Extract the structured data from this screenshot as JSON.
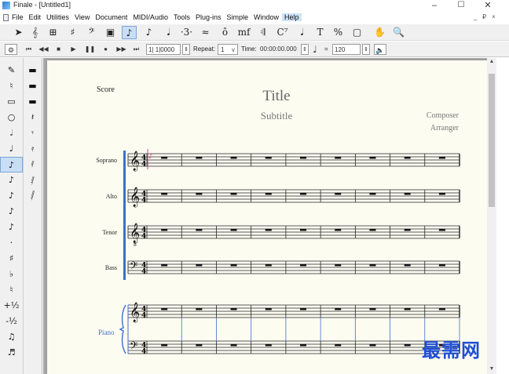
{
  "window": {
    "title": "Finale - [Untitled1]",
    "controls": {
      "minimize": "–",
      "maximize": "☐",
      "close": "✕"
    }
  },
  "menubar": {
    "items": [
      "File",
      "Edit",
      "Utilities",
      "View",
      "Document",
      "MIDI/Audio",
      "Tools",
      "Plug-ins",
      "Simple",
      "Window",
      "Help"
    ],
    "highlighted": "Help",
    "mdi_controls": {
      "minimize": "_",
      "restore": "₽",
      "close": "×"
    }
  },
  "main_tools": [
    {
      "name": "selection-tool",
      "glyph": "➤"
    },
    {
      "name": "staff-tool",
      "glyph": "𝄞"
    },
    {
      "name": "measure-tool",
      "glyph": "⊞"
    },
    {
      "name": "key-signature-tool",
      "glyph": "♯"
    },
    {
      "name": "time-signature-tool",
      "glyph": "𝄢"
    },
    {
      "name": "clef-tool",
      "glyph": "▣"
    },
    {
      "name": "simple-entry-tool",
      "glyph": "♪"
    },
    {
      "name": "speedy-entry-tool",
      "glyph": "♪"
    },
    {
      "name": "hyperscribe-tool",
      "glyph": "𝅘𝅥"
    },
    {
      "name": "tuplet-tool",
      "glyph": "·3·"
    },
    {
      "name": "smart-shape-tool",
      "glyph": "≈"
    },
    {
      "name": "articulation-tool",
      "glyph": "ô"
    },
    {
      "name": "expression-tool",
      "glyph": "mf"
    },
    {
      "name": "repeat-tool",
      "glyph": "𝄇"
    },
    {
      "name": "chord-tool",
      "glyph": "C⁷"
    },
    {
      "name": "lyrics-tool",
      "glyph": "𝅘𝅥"
    },
    {
      "name": "text-tool",
      "glyph": "T"
    },
    {
      "name": "resize-tool",
      "glyph": "%"
    },
    {
      "name": "page-layout-tool",
      "glyph": "▢"
    },
    {
      "name": "hand-grabber-tool",
      "glyph": "✋"
    },
    {
      "name": "zoom-tool",
      "glyph": "🔍"
    }
  ],
  "playback": {
    "buttons": [
      {
        "name": "rewind-to-start",
        "glyph": "⏮"
      },
      {
        "name": "rewind",
        "glyph": "◀◀"
      },
      {
        "name": "stop",
        "glyph": "■"
      },
      {
        "name": "play",
        "glyph": "▶"
      },
      {
        "name": "pause",
        "glyph": "❚❚"
      },
      {
        "name": "record",
        "glyph": "●"
      },
      {
        "name": "fast-forward",
        "glyph": "▶▶"
      },
      {
        "name": "forward-to-end",
        "glyph": "⏭"
      }
    ],
    "counter": "1| 1|0000",
    "repeat_label": "Repeat:",
    "repeat_value": "1",
    "time_label": "Time:",
    "time_value": "00:00:00.000",
    "equals": "=",
    "tempo": "120"
  },
  "simple_entry_palette": [
    {
      "name": "eraser-icon",
      "glyph": "✎"
    },
    {
      "name": "voice-icon",
      "glyph": "♮"
    },
    {
      "name": "tablature-icon",
      "glyph": "▭"
    },
    {
      "name": "whole-note-icon",
      "glyph": "○"
    },
    {
      "name": "half-note-icon",
      "glyph": "𝅗𝅥"
    },
    {
      "name": "quarter-note-icon",
      "glyph": "♩"
    },
    {
      "name": "eighth-note-icon",
      "glyph": "♪",
      "selected": true
    },
    {
      "name": "sixteenth-note-icon",
      "glyph": "♪"
    },
    {
      "name": "thirty-second-note-icon",
      "glyph": "♪"
    },
    {
      "name": "sixty-fourth-note-icon",
      "glyph": "♪"
    },
    {
      "name": "one-twenty-eighth-note-icon",
      "glyph": "♪"
    },
    {
      "name": "dot-icon",
      "glyph": "·"
    },
    {
      "name": "sharp-icon",
      "glyph": "♯"
    },
    {
      "name": "flat-icon",
      "glyph": "♭"
    },
    {
      "name": "natural-icon",
      "glyph": "♮"
    },
    {
      "name": "half-step-up-icon",
      "glyph": "+½"
    },
    {
      "name": "half-step-down-icon",
      "glyph": "-½"
    },
    {
      "name": "tie-icon",
      "glyph": "♫"
    },
    {
      "name": "grace-note-icon",
      "glyph": "♬"
    }
  ],
  "rests_palette": [
    {
      "name": "whole-rest-icon",
      "glyph": "▬"
    },
    {
      "name": "half-rest-icon",
      "glyph": "▬"
    },
    {
      "name": "double-whole-rest-icon",
      "glyph": "▬"
    },
    {
      "name": "quarter-rest-icon",
      "glyph": "𝄽"
    },
    {
      "name": "eighth-rest-icon",
      "glyph": "𝄾"
    },
    {
      "name": "sixteenth-rest-icon",
      "glyph": "𝄿"
    },
    {
      "name": "thirty-second-rest-icon",
      "glyph": "𝅀"
    },
    {
      "name": "sixty-fourth-rest-icon",
      "glyph": "𝅁"
    },
    {
      "name": "one-twenty-eighth-rest-icon",
      "glyph": "𝅂"
    }
  ],
  "score": {
    "label": "Score",
    "title": "Title",
    "subtitle": "Subtitle",
    "composer": "Composer",
    "arranger": "Arranger",
    "time_signature": "4",
    "staves": [
      {
        "name": "Soprano",
        "clef": "treble"
      },
      {
        "name": "Alto",
        "clef": "treble"
      },
      {
        "name": "Tenor",
        "clef": "treble8"
      },
      {
        "name": "Bass",
        "clef": "bass"
      }
    ],
    "piano": {
      "name": "Piano"
    }
  },
  "watermark": "最需网"
}
